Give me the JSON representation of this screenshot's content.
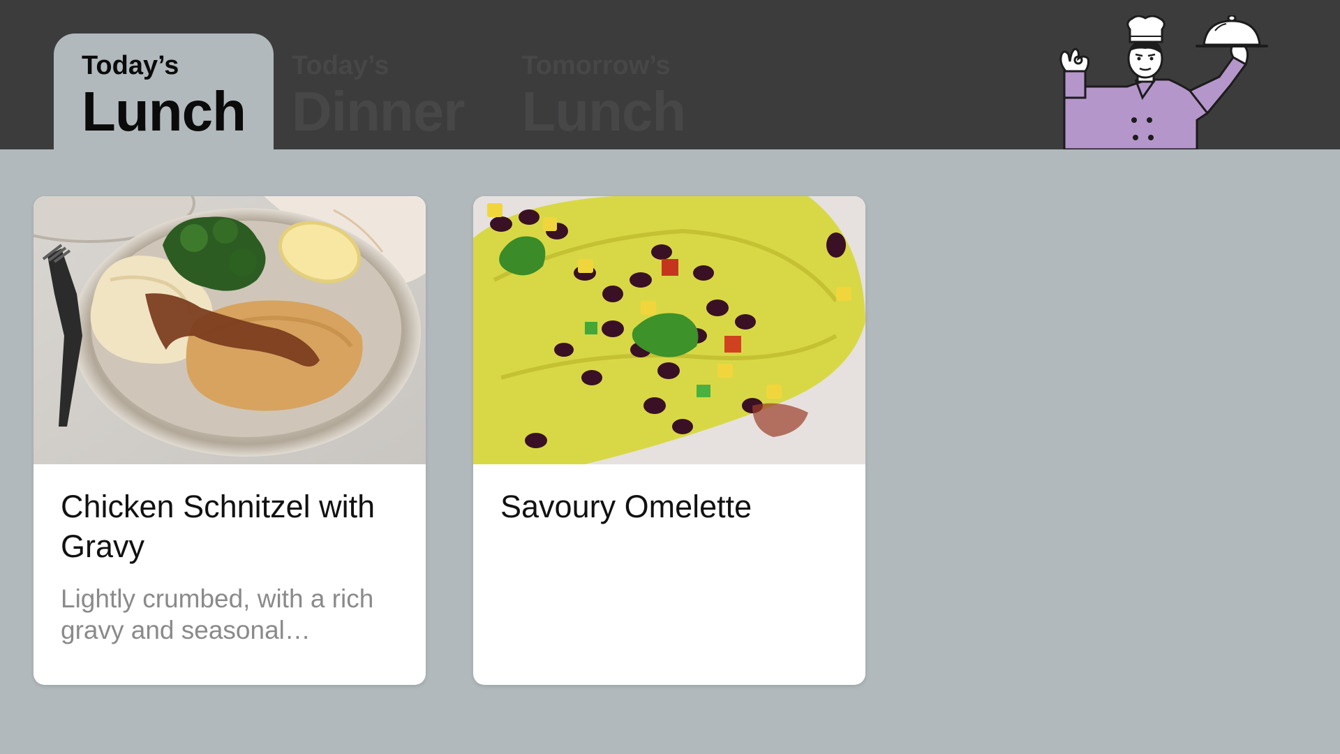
{
  "header": {
    "tabs": [
      {
        "day": "Today’s",
        "meal": "Lunch",
        "active": true
      },
      {
        "day": "Today’s",
        "meal": "Dinner",
        "active": false
      },
      {
        "day": "Tomorrow’s",
        "meal": "Lunch",
        "active": false
      }
    ]
  },
  "meals": [
    {
      "title": "Chicken Schnitzel with Gravy",
      "description": "Lightly crumbed, with a rich gravy and seasonal…"
    },
    {
      "title": "Savoury Omelette",
      "description": ""
    }
  ],
  "colors": {
    "header_bg": "#3c3c3d",
    "page_bg": "#b1b9bc",
    "inactive_tab_text": "#474748",
    "chef_jacket": "#b596ca"
  },
  "icons": {
    "chef": "chef-holding-cloche-illustration"
  }
}
